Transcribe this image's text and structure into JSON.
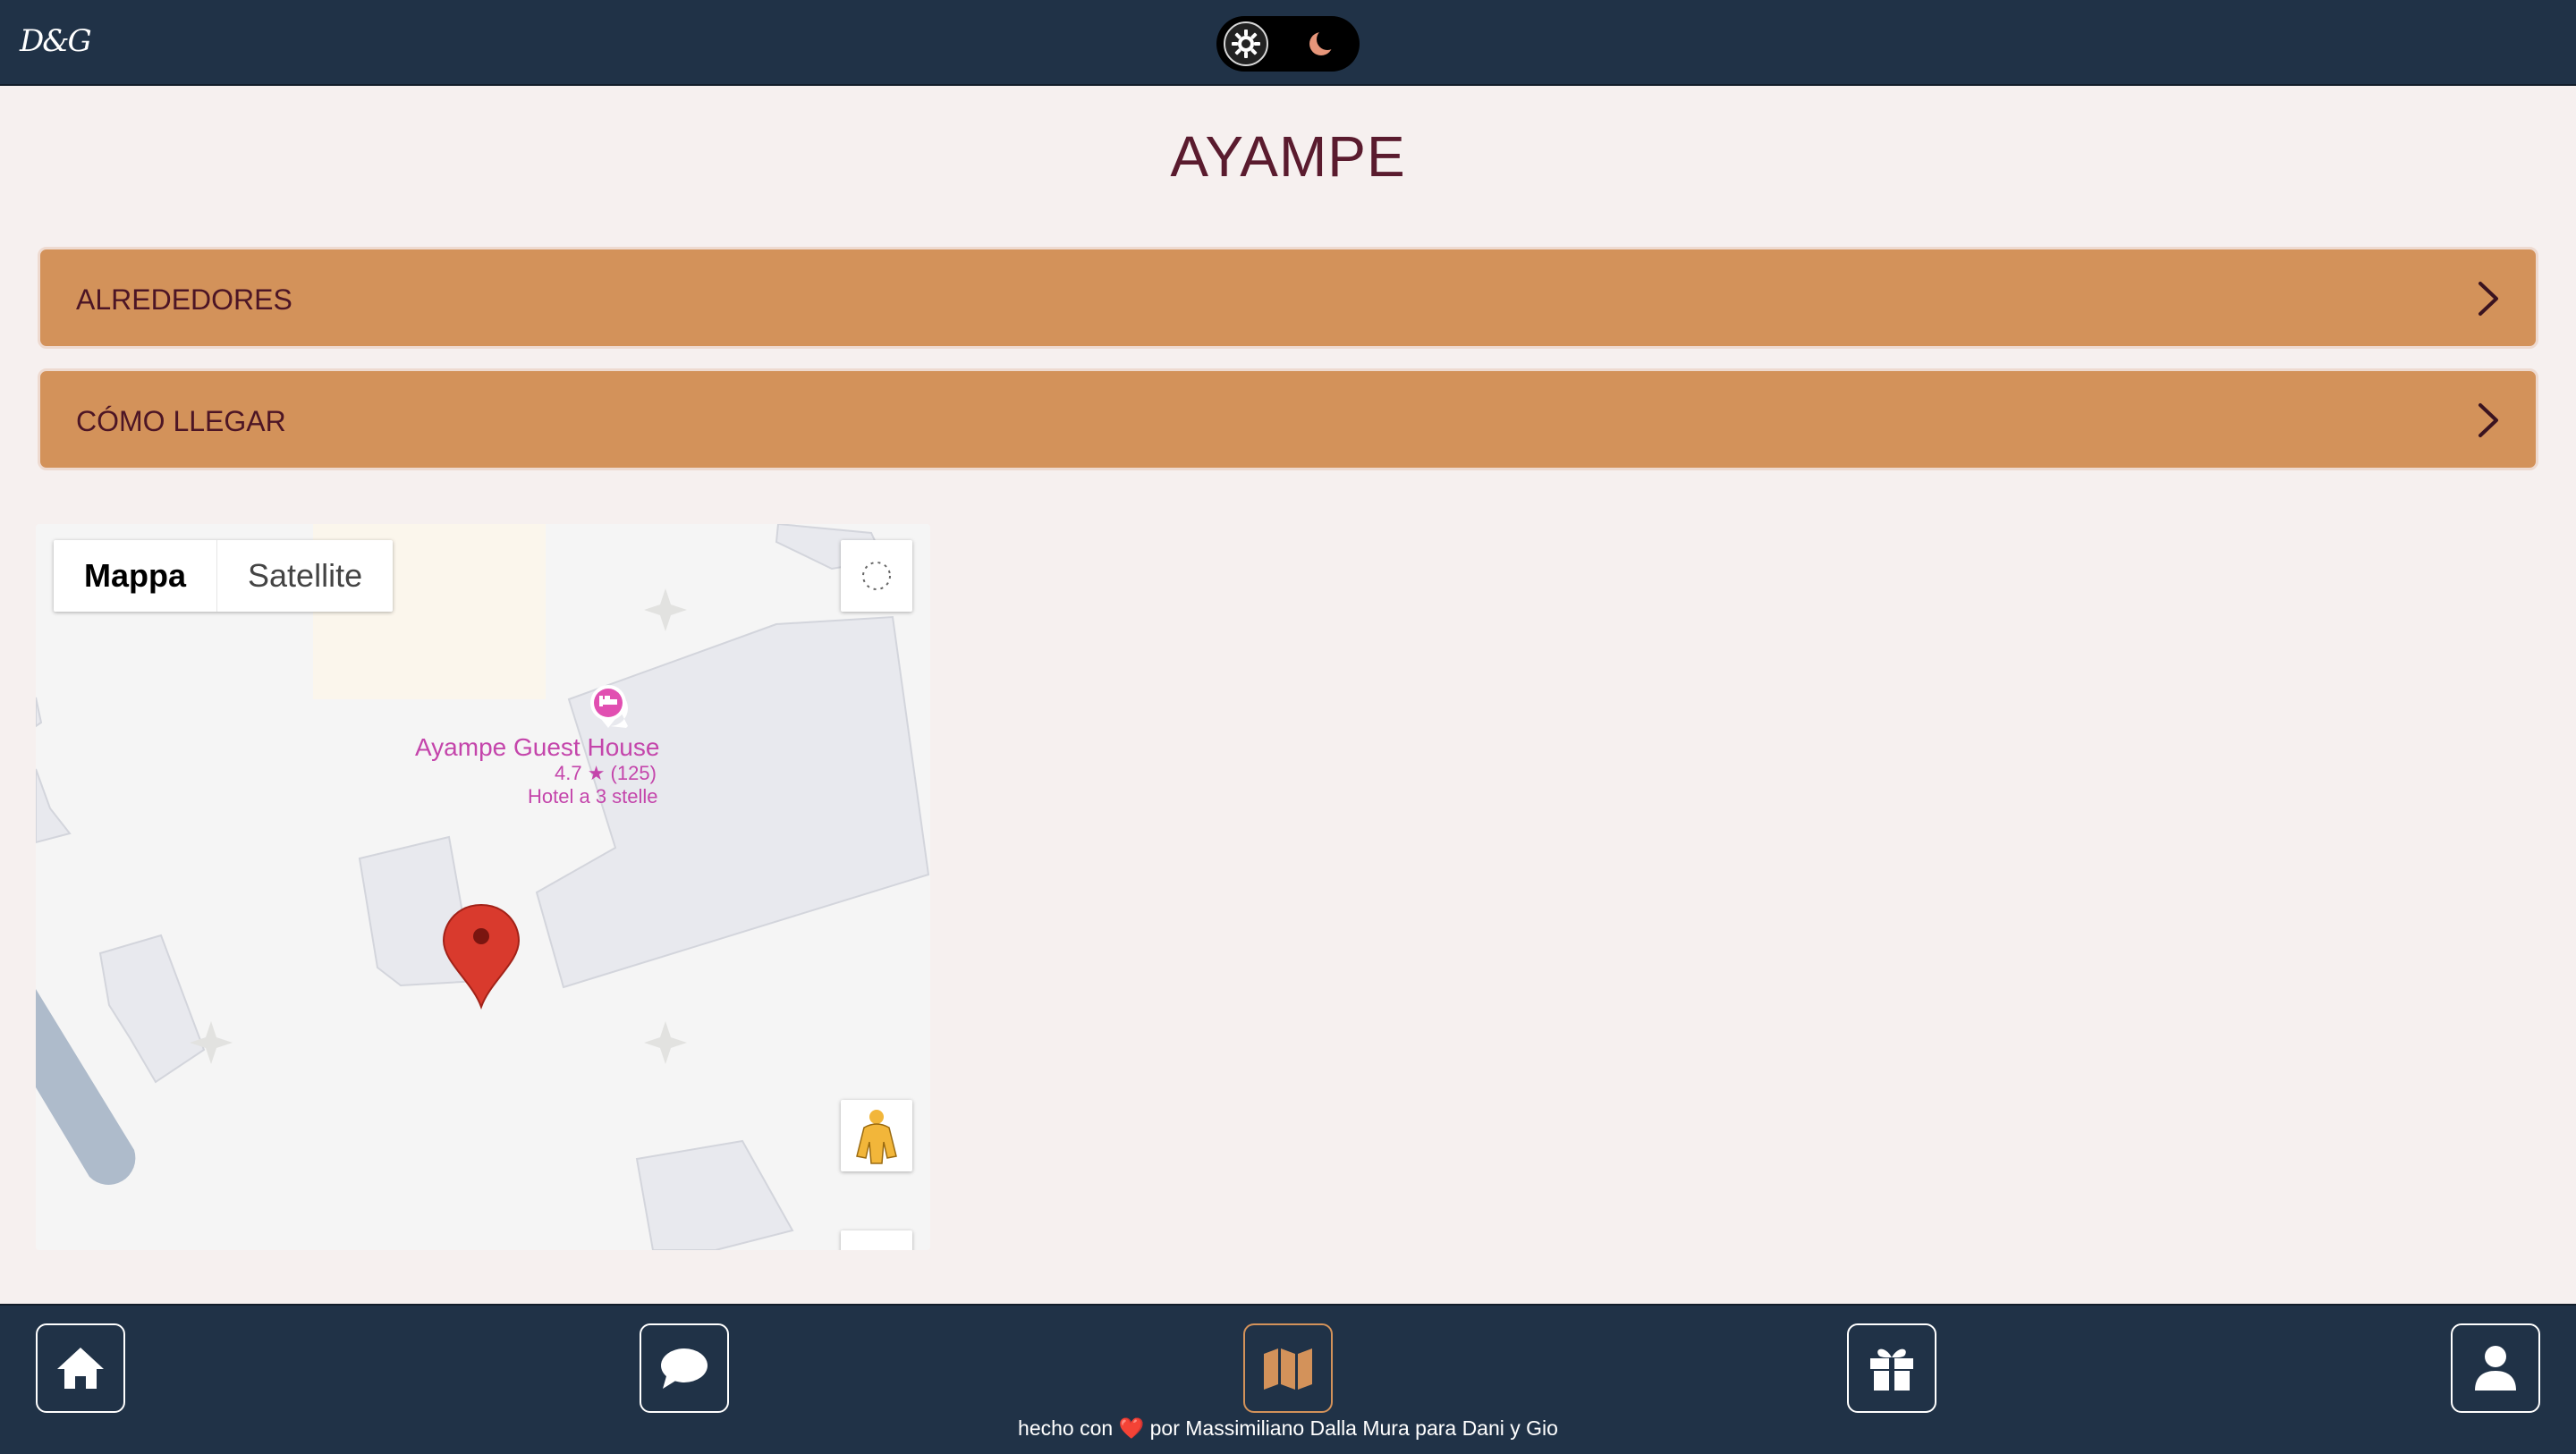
{
  "header": {
    "logo_text": "D&G",
    "theme_toggle": {
      "mode": "light"
    }
  },
  "page": {
    "title": "AYAMPE"
  },
  "sections": [
    {
      "label": "ALREDEDORES",
      "icon": "chevron-right-icon"
    },
    {
      "label": "CÓMO LLEGAR",
      "icon": "chevron-right-icon"
    }
  ],
  "map": {
    "type_control": {
      "map_label": "Mappa",
      "satellite_label": "Satellite",
      "selected": "Mappa"
    },
    "poi": {
      "name": "Ayampe Guest House",
      "rating": "4.7 ★ (125)",
      "category": "Hotel a 3 stelle",
      "icon": "hotel-bed-icon"
    },
    "marker": "red-location-pin-icon",
    "controls": [
      "fullscreen-icon",
      "pegman-icon"
    ]
  },
  "bottom_nav": {
    "items": [
      {
        "name": "home",
        "icon": "home-icon"
      },
      {
        "name": "chat",
        "icon": "chat-bubble-icon"
      },
      {
        "name": "map",
        "icon": "map-icon",
        "active": true
      },
      {
        "name": "gifts",
        "icon": "gift-icon"
      },
      {
        "name": "profile",
        "icon": "user-icon"
      }
    ],
    "footer": {
      "prefix": "hecho con",
      "heart": "❤️",
      "suffix": "por Massimiliano Dalla Mura para Dani y Gio"
    }
  },
  "colors": {
    "navbar": "#203247",
    "background": "#f6f0ef",
    "accent": "#d3925a",
    "title": "#5a1b2e",
    "poi": "#c445ab",
    "marker": "#d93a2d"
  }
}
